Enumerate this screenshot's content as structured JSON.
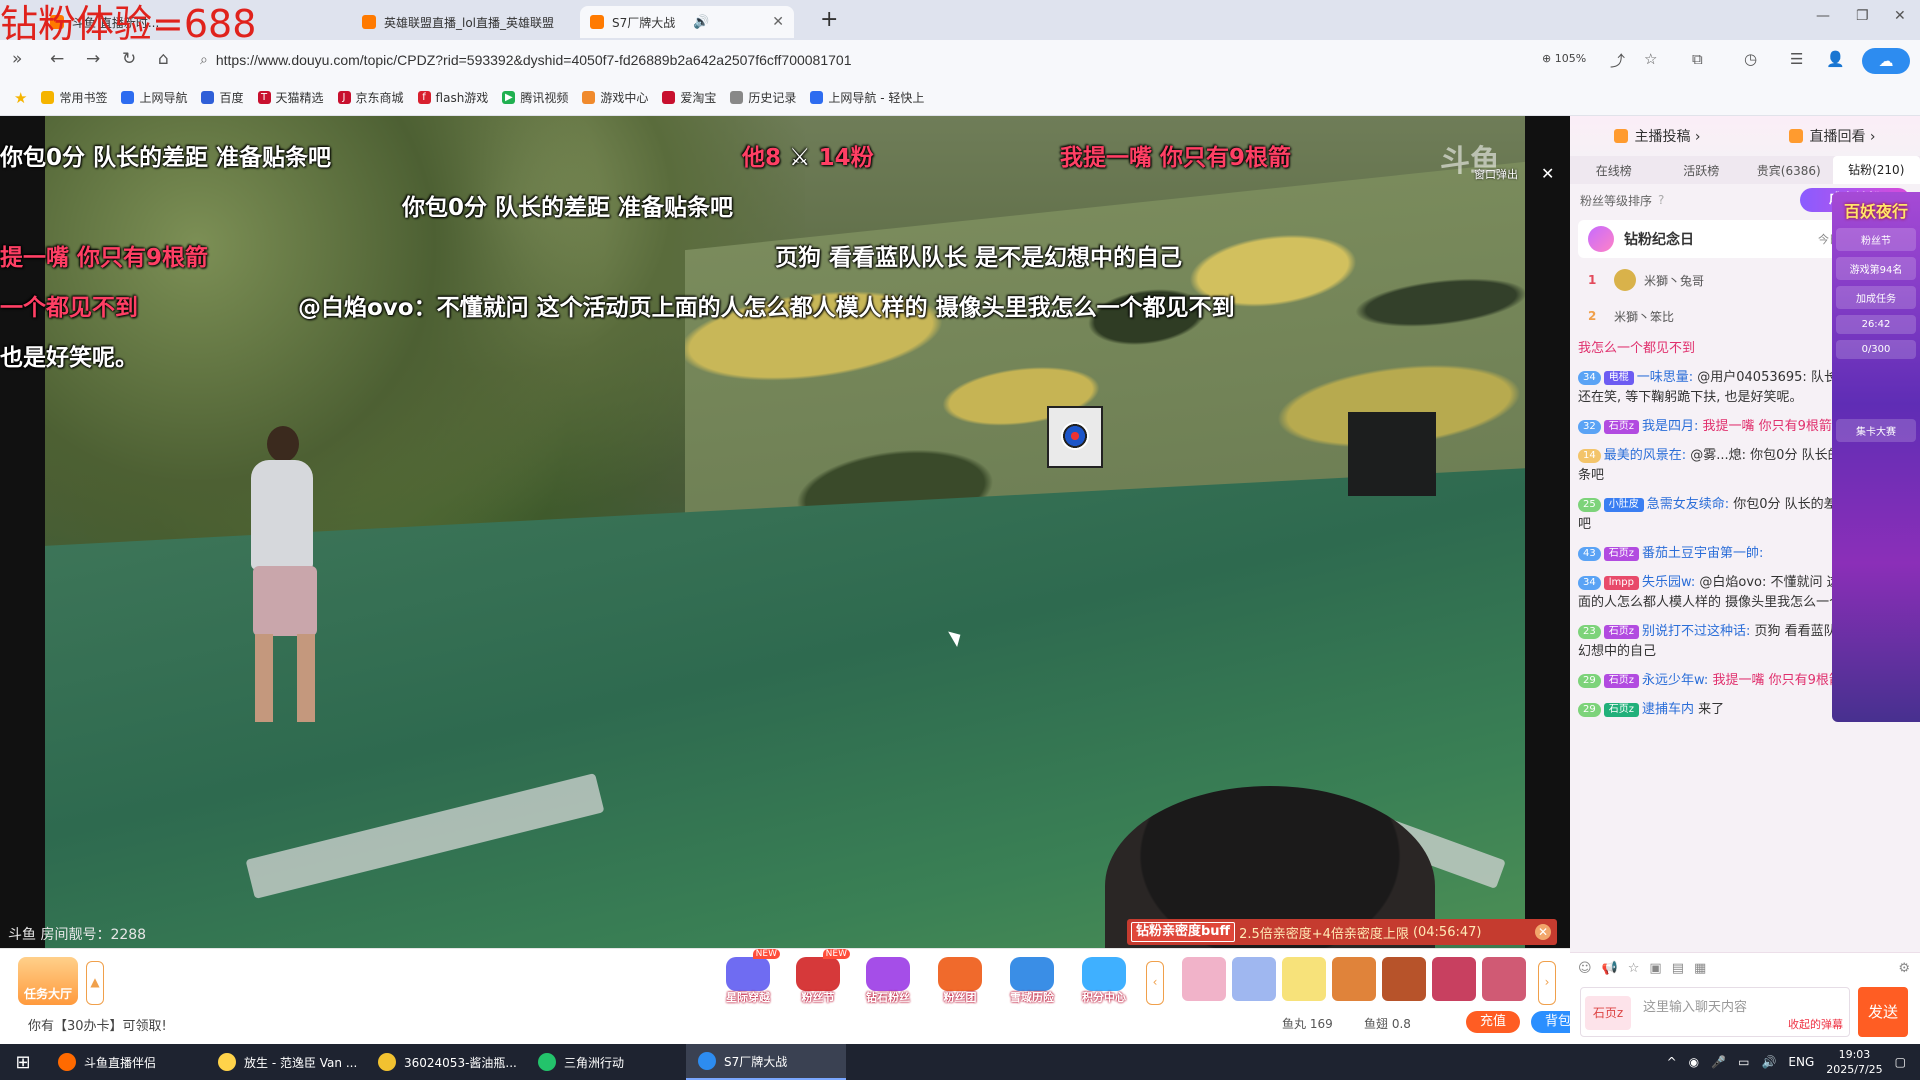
{
  "overlay": {
    "badge_text": "钻粉体验=688"
  },
  "tabs": [
    {
      "title": "斗鱼  直播新时..."
    },
    {
      "title": "英雄联盟直播_lol直播_英雄联盟"
    },
    {
      "title": "S7厂牌大战"
    }
  ],
  "address": {
    "url": "https://www.douyu.com/topic/CPDZ?rid=593392&dyshid=4050f7-fd26889b2a642a2507f6cff700081701",
    "zoom": "105%"
  },
  "bookmarks": [
    "常用书签",
    "上网导航",
    "百度",
    "天猫精选",
    "京东商城",
    "flash游戏",
    "腾讯视频",
    "游戏中心",
    "爱淘宝",
    "历史记录",
    "上网导航 - 轻快上"
  ],
  "danmu": [
    {
      "text": "你包0分 队长的差距 准备贴条吧",
      "color": "#ffffff"
    },
    {
      "text": "他8",
      "suffix": "14粉",
      "color": "#ff3f64"
    },
    {
      "text": "我提一嘴 你只有9根箭",
      "color": "#ff3f64"
    },
    {
      "text": "你包0分 队长的差距 准备贴条吧",
      "color": "#ffffff"
    },
    {
      "text": "页狗 看看蓝队队长 是不是幻想中的自己",
      "color": "#ffffff"
    },
    {
      "text": "提一嘴 你只有9根箭",
      "color": "#ff3f64"
    },
    {
      "text": "一个都见不到",
      "color": "#ff3f64"
    },
    {
      "text": "@白焰ovo：不懂就问 这个活动页上面的人怎么都人模人样的 摄像头里我怎么一个都见不到",
      "color": "#ffffff"
    },
    {
      "text": "也是好笑呢。",
      "color": "#ffffff"
    }
  ],
  "video": {
    "popout_label": "窗口弹出",
    "room_number": "斗鱼 房间靓号：2288",
    "buff_tag": "钻粉亲密度buff",
    "buff_text": "2.5倍亲密度+4倍亲密度上限",
    "buff_timer": "(04:56:47)"
  },
  "giftbar": {
    "task_hall": "任务大厅",
    "claim_text": "你有【30办卡】可领取!",
    "activities": [
      {
        "label": "星际穿越",
        "new": "NEW",
        "color": "#6f6cf2"
      },
      {
        "label": "粉丝节",
        "new": "NEW",
        "color": "#d6393a"
      },
      {
        "label": "钻石粉丝",
        "new": "",
        "color": "#a54ee8"
      },
      {
        "label": "粉丝团",
        "new": "",
        "color": "#f06a2c"
      },
      {
        "label": "雪域历险",
        "new": "",
        "color": "#3a8ee6"
      },
      {
        "label": "积分中心",
        "new": "",
        "color": "#3fb0ff"
      }
    ],
    "fish_balls": "鱼丸 169",
    "fish_fin": "鱼翅 0.8",
    "recharge": "充值",
    "bag": "背包"
  },
  "side": {
    "top_left": "主播投稿",
    "top_right": "直播回看",
    "rank_tabs": [
      "在线榜",
      "活跃榜",
      "贵宾(6386)",
      "钻粉(210)"
    ],
    "fan_sort": "粉丝等级排序",
    "become_fan": "成为钻粉",
    "anniversary": "钻粉纪念日",
    "anniversary_note": "今日共有4位粉丝",
    "ranks": [
      {
        "no": "1",
        "name": "米獅丶兔哥"
      },
      {
        "no": "2",
        "name": "米獅丶笨比"
      }
    ],
    "messages": [
      {
        "level": "",
        "fan": "",
        "nick": "",
        "text": "我怎么一个都见不到",
        "pink": true
      },
      {
        "level": "34",
        "fan": "电棍",
        "nick": "一味思量:",
        "text": "@用户04053695: 队长在拿分了, 页还在笑, 等下鞠躬跪下扶, 也是好笑呢。"
      },
      {
        "level": "32",
        "fan": "石页z",
        "nick": "我是四月:",
        "text": "我提一嘴 你只有9根箭"
      },
      {
        "level": "14",
        "fan": "",
        "nick": "最美的风景在:",
        "text": "@雾...熄: 你包0分 队长的差距 准备贴条吧"
      },
      {
        "level": "25",
        "fan": "小肚皮",
        "nick": "急需女友续命:",
        "text": "你包0分 队长的差距 准备贴条吧"
      },
      {
        "level": "43",
        "fan": "石页z",
        "nick": "番茄土豆宇宙第一帥:",
        "text": ""
      },
      {
        "level": "34",
        "fan": "lmpp",
        "nick": "失乐园w:",
        "text": "@白焰ovo: 不懂就问 这个活动页上面的人怎么都人模人样的 摄像头里我怎么一个都见不到"
      },
      {
        "level": "23",
        "fan": "石页z",
        "nick": "别说打不过这种话:",
        "text": "页狗 看看蓝队队长 是不是幻想中的自己"
      },
      {
        "level": "29",
        "fan": "石页z",
        "nick": "永远少年w:",
        "text": "我提一嘴 你只有9根箭"
      },
      {
        "level": "29",
        "fan": "石页z",
        "nick": "逮捕车内",
        "text": "来了"
      }
    ],
    "banner": {
      "title": "百妖夜行",
      "sub1": "粉丝节",
      "sub2": "游戏第94名",
      "task": "加成任务",
      "timer": "26:42",
      "count": "0/300",
      "bottom": "集卡大赛"
    },
    "input_badge": "石页z",
    "input_placeholder": "这里输入聊天内容",
    "fold_text": "收起的弹幕",
    "send": "发送"
  },
  "taskbar": {
    "items": [
      {
        "label": "斗鱼直播伴侣",
        "color": "#ff6a00"
      },
      {
        "label": "放生 - 范逸臣 Van ...",
        "color": "#ffd34a"
      },
      {
        "label": "36024053-酱油瓶...",
        "color": "#f2c230"
      },
      {
        "label": "三角洲行动",
        "color": "#23c36b"
      },
      {
        "label": "S7厂牌大战",
        "color": "#2d8cf0"
      }
    ],
    "lang": "ENG",
    "time": "19:03",
    "date": "2025/7/25"
  }
}
